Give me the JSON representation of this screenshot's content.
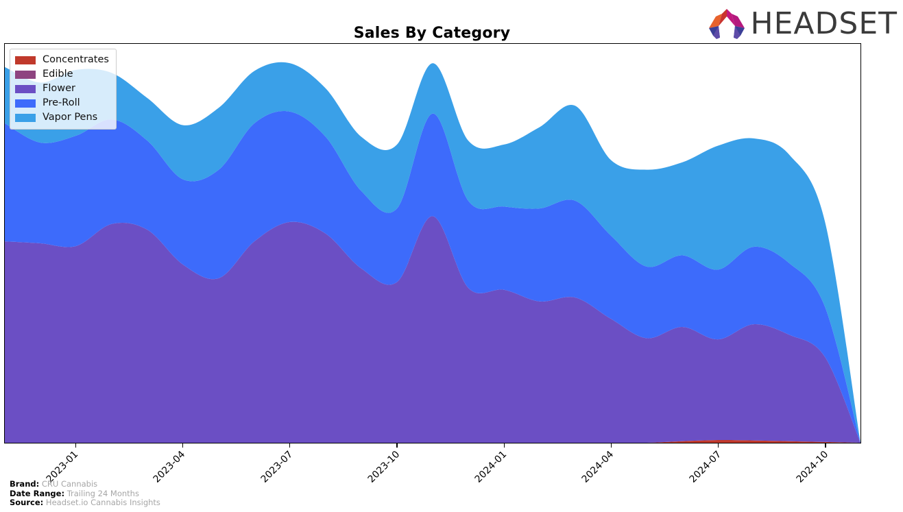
{
  "header": {
    "title": "Sales By Category",
    "logo": {
      "name": "headset-logo",
      "wordmark": "HEADSET",
      "mark_colors": [
        "#E8622C",
        "#C9342F",
        "#C2187E",
        "#3B3F97",
        "#5D4BA8"
      ],
      "word_color": "#3b3b3b"
    }
  },
  "legend": {
    "position": "upper-left",
    "items": [
      {
        "label": "Concentrates",
        "color": "#C0392B"
      },
      {
        "label": "Edible",
        "color": "#8E4480"
      },
      {
        "label": "Flower",
        "color": "#6B4FC4"
      },
      {
        "label": "Pre-Roll",
        "color": "#3D6BFB"
      },
      {
        "label": "Vapor Pens",
        "color": "#3AA0E8"
      }
    ]
  },
  "footer": {
    "rows": [
      {
        "key": "Brand:",
        "value": "CRU Cannabis"
      },
      {
        "key": "Date Range:",
        "value": "Trailing 24 Months"
      },
      {
        "key": "Source:",
        "value": "Headset.io Cannabis Insights"
      }
    ]
  },
  "chart_data": {
    "type": "area",
    "stacked": true,
    "smoothing": "spline",
    "title": "Sales By Category",
    "xlabel": "",
    "ylabel": "",
    "grid": false,
    "legend_position": "upper left",
    "axis": {
      "x_tick_labels": [
        "2023-01",
        "2023-04",
        "2023-07",
        "2023-10",
        "2024-01",
        "2024-04",
        "2024-07",
        "2024-10"
      ],
      "x_tick_rotation": -45,
      "y_tick_labels": [],
      "ylim": [
        0,
        100
      ]
    },
    "x": [
      "2022-11",
      "2022-12",
      "2023-01",
      "2023-02",
      "2023-03",
      "2023-04",
      "2023-05",
      "2023-06",
      "2023-07",
      "2023-08",
      "2023-09",
      "2023-10",
      "2023-11",
      "2023-12",
      "2024-01",
      "2024-02",
      "2024-03",
      "2024-04",
      "2024-05",
      "2024-06",
      "2024-07",
      "2024-08",
      "2024-09",
      "2024-10",
      "2024-11"
    ],
    "categories": [
      "2022-11",
      "2022-12",
      "2023-01",
      "2023-02",
      "2023-03",
      "2023-04",
      "2023-05",
      "2023-06",
      "2023-07",
      "2023-08",
      "2023-09",
      "2023-10",
      "2023-11",
      "2023-12",
      "2024-01",
      "2024-02",
      "2024-03",
      "2024-04",
      "2024-05",
      "2024-06",
      "2024-07",
      "2024-08",
      "2024-09",
      "2024-10",
      "2024-11"
    ],
    "series": [
      {
        "name": "Concentrates",
        "color": "#C0392B",
        "values": [
          0,
          0,
          0,
          0,
          0,
          0,
          0,
          0,
          0,
          0,
          0,
          0,
          0,
          0,
          0,
          0,
          0,
          0,
          0,
          0.4,
          0.7,
          0.6,
          0.4,
          0.2,
          0
        ]
      },
      {
        "name": "Edible",
        "color": "#8E4480",
        "values": [
          0,
          0,
          0,
          0,
          0,
          0,
          0,
          0,
          0,
          0,
          0,
          0,
          0,
          0,
          0,
          0,
          0,
          0,
          0,
          0,
          0,
          0,
          0,
          0,
          0
        ]
      },
      {
        "name": "Flower",
        "color": "#6B4FC4",
        "values": [
          52.0,
          51.5,
          50.8,
          56.5,
          55.0,
          46.0,
          42.5,
          52.0,
          57.0,
          54.0,
          45.0,
          41.5,
          58.5,
          40.0,
          39.5,
          36.5,
          37.5,
          32.0,
          27.0,
          29.5,
          26.0,
          30.0,
          27.5,
          22.0,
          0
        ]
      },
      {
        "name": "Pre-Roll",
        "color": "#3D6BFB",
        "values": [
          30.5,
          26.0,
          28.5,
          27.0,
          23.0,
          22.0,
          28.0,
          30.5,
          28.5,
          25.0,
          20.0,
          19.0,
          26.5,
          22.5,
          21.5,
          24.0,
          25.0,
          21.5,
          18.5,
          18.5,
          18.0,
          20.0,
          18.5,
          13.0,
          0
        ]
      },
      {
        "name": "Vapor Pens",
        "color": "#3AA0E8",
        "values": [
          14.5,
          15.5,
          17.0,
          12.0,
          11.0,
          14.0,
          16.0,
          13.5,
          12.5,
          12.5,
          14.0,
          16.5,
          13.0,
          15.5,
          16.0,
          21.0,
          24.5,
          19.5,
          25.0,
          24.0,
          32.0,
          28.0,
          28.0,
          22.0,
          0
        ]
      }
    ]
  }
}
